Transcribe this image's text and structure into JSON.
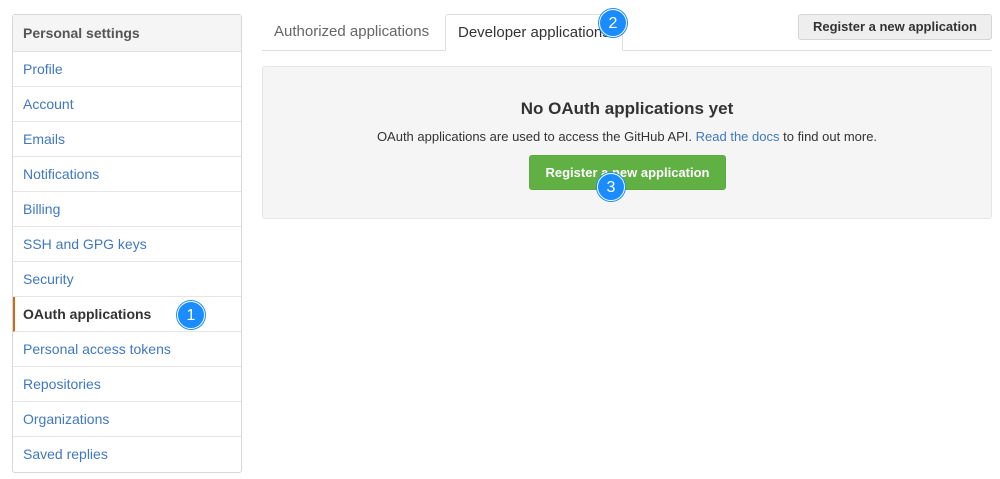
{
  "sidebar": {
    "title": "Personal settings",
    "items": [
      {
        "label": "Profile"
      },
      {
        "label": "Account"
      },
      {
        "label": "Emails"
      },
      {
        "label": "Notifications"
      },
      {
        "label": "Billing"
      },
      {
        "label": "SSH and GPG keys"
      },
      {
        "label": "Security"
      },
      {
        "label": "OAuth applications"
      },
      {
        "label": "Personal access tokens"
      },
      {
        "label": "Repositories"
      },
      {
        "label": "Organizations"
      },
      {
        "label": "Saved replies"
      }
    ],
    "selected_index": 7
  },
  "tabs": [
    {
      "label": "Authorized applications"
    },
    {
      "label": "Developer applications"
    }
  ],
  "header": {
    "register_button": "Register a new application"
  },
  "blankslate": {
    "title": "No OAuth applications yet",
    "desc_prefix": "OAuth applications are used to access the GitHub API.",
    "desc_link": "Read the docs",
    "desc_suffix": "to find out more.",
    "button": "Register a new application"
  },
  "callouts": [
    "1",
    "2",
    "3"
  ],
  "colors": {
    "link": "#4078c0",
    "accent": "#d26911",
    "green": "#60b044",
    "badge": "#1a8cff"
  }
}
